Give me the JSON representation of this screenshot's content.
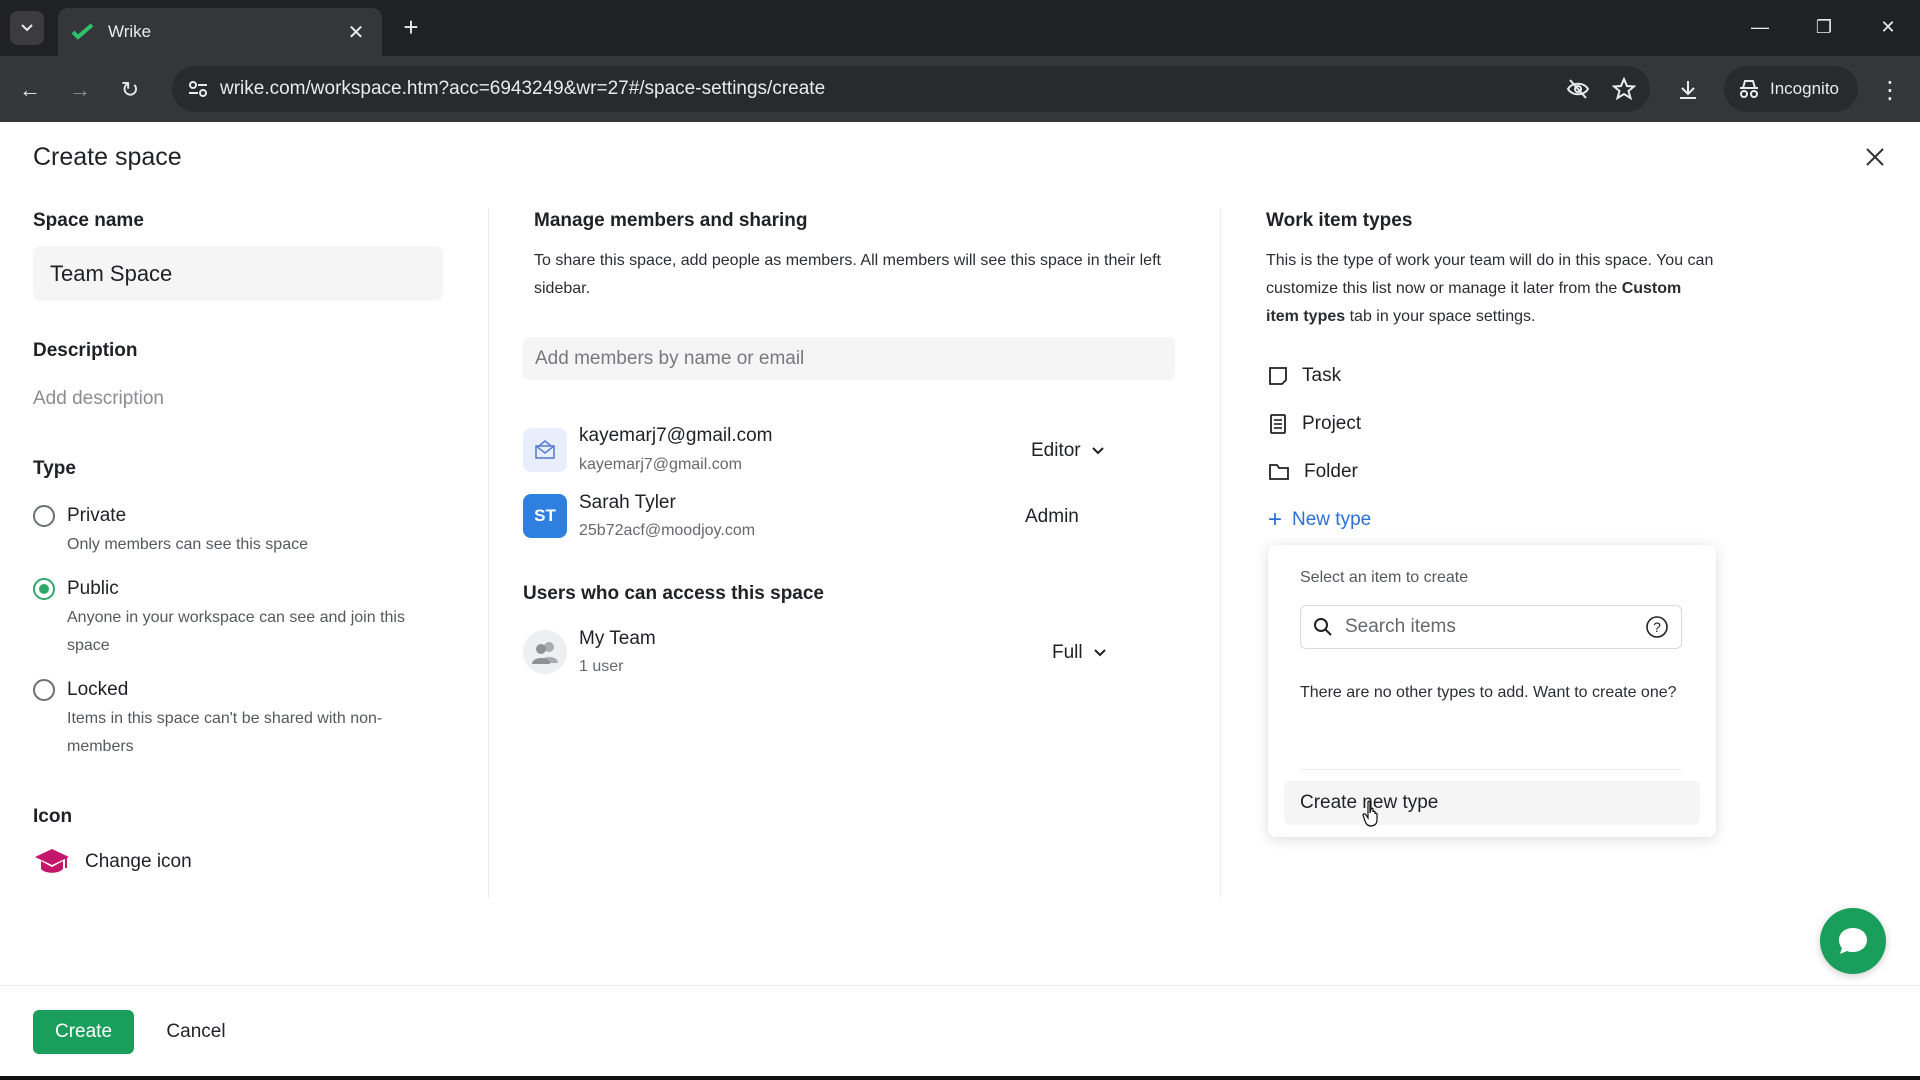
{
  "browser": {
    "tab_title": "Wrike",
    "url": "wrike.com/workspace.htm?acc=6943249&wr=27#/space-settings/create",
    "incognito_label": "Incognito"
  },
  "page": {
    "title": "Create space"
  },
  "left": {
    "space_name_label": "Space name",
    "space_name_value": "Team Space",
    "description_label": "Description",
    "description_placeholder": "Add description",
    "type_label": "Type",
    "types": [
      {
        "label": "Private",
        "sub": "Only members can see this space",
        "checked": false
      },
      {
        "label": "Public",
        "sub": "Anyone in your workspace can see and join this space",
        "checked": true
      },
      {
        "label": "Locked",
        "sub": "Items in this space can't be shared with non-members",
        "checked": false
      }
    ],
    "icon_label": "Icon",
    "change_icon_label": "Change icon"
  },
  "members": {
    "title": "Manage members and sharing",
    "desc": "To share this space, add people as members. All members will see this space in their left sidebar.",
    "input_placeholder": "Add members by name or email",
    "list": [
      {
        "name": "kayemarj7@gmail.com",
        "email": "kayemarj7@gmail.com",
        "role": "Editor"
      },
      {
        "name": "Sarah Tyler",
        "email": "25b72acf@moodjoy.com",
        "role": "Admin",
        "initials": "ST"
      }
    ],
    "access_title": "Users who can access this space",
    "team": {
      "name": "My Team",
      "count": "1 user",
      "role": "Full"
    }
  },
  "work_types": {
    "title": "Work item types",
    "desc_1": "This is the type of work your team will do in this space. You can customize this list now or manage it later from the",
    "desc_bold": "Custom item types",
    "desc_2": "tab in your space settings.",
    "items": [
      "Task",
      "Project",
      "Folder"
    ],
    "new_type_label": "New type",
    "dropdown": {
      "header": "Select an item to create",
      "search_placeholder": "Search items",
      "empty_text": "There are no other types to add. Want to create one?",
      "create_label": "Create new type"
    }
  },
  "footer": {
    "create_label": "Create",
    "cancel_label": "Cancel"
  },
  "colors": {
    "accent_green": "#1a9e5c",
    "link_blue": "#2c6fd6",
    "avatar_blue": "#2f7fe0"
  }
}
